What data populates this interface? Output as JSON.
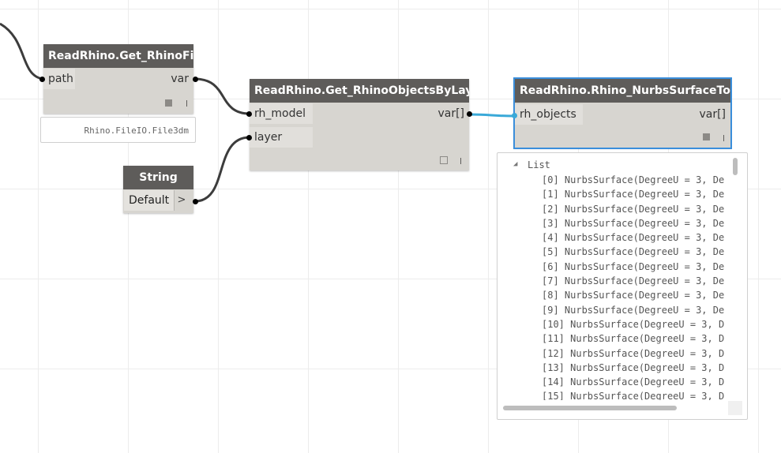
{
  "nodes": {
    "get_file": {
      "title": "ReadRhino.Get_RhinoFile",
      "input": "path",
      "output": "var",
      "preview": "Rhino.FileIO.File3dm"
    },
    "get_objects": {
      "title": "ReadRhino.Get_RhinoObjectsByLayer",
      "input1": "rh_model",
      "input2": "layer",
      "output": "var[]"
    },
    "nurbs": {
      "title": "ReadRhino.Rhino_NurbsSurfaceToDS",
      "input": "rh_objects",
      "output": "var[]"
    },
    "string": {
      "title": "String",
      "value": "Default",
      "arrow": ">"
    }
  },
  "preview_list": {
    "title": "List",
    "items": [
      "[0] NurbsSurface(DegreeU = 3, De",
      "[1] NurbsSurface(DegreeU = 3, De",
      "[2] NurbsSurface(DegreeU = 3, De",
      "[3] NurbsSurface(DegreeU = 3, De",
      "[4] NurbsSurface(DegreeU = 3, De",
      "[5] NurbsSurface(DegreeU = 3, De",
      "[6] NurbsSurface(DegreeU = 3, De",
      "[7] NurbsSurface(DegreeU = 3, De",
      "[8] NurbsSurface(DegreeU = 3, De",
      "[9] NurbsSurface(DegreeU = 3, De",
      "[10] NurbsSurface(DegreeU = 3, D",
      "[11] NurbsSurface(DegreeU = 3, D",
      "[12] NurbsSurface(DegreeU = 3, D",
      "[13] NurbsSurface(DegreeU = 3, D",
      "[14] NurbsSurface(DegreeU = 3, D",
      "[15] NurbsSurface(DegreeU = 3, D"
    ]
  },
  "colors": {
    "header": "#5e5c5a",
    "body": "#d7d5d0",
    "wire": "#3c3c3c",
    "selected_wire": "#3aa9d8",
    "selection": "#3a8edb"
  }
}
